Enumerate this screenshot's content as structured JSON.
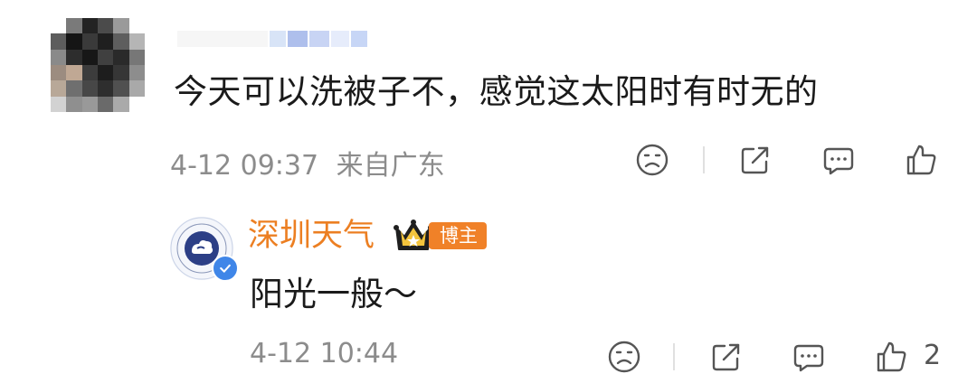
{
  "comment": {
    "text": "今天可以洗被子不，感觉这太阳时有时无的",
    "date_time": "4-12 09:37",
    "location": "来自广东",
    "actions": {
      "dislike_icon": "sad-face-icon",
      "share_icon": "share-icon",
      "reply_icon": "comment-icon",
      "like_icon": "thumbs-up-icon"
    }
  },
  "reply": {
    "username": "深圳天气",
    "badge": "博主",
    "text": "阳光一般～",
    "date_time": "4-12 10:44",
    "like_count": "2"
  },
  "colors": {
    "accent_orange": "#ec7f22",
    "meta_gray": "#8c8c8c",
    "verified_blue": "#3f86e8"
  }
}
